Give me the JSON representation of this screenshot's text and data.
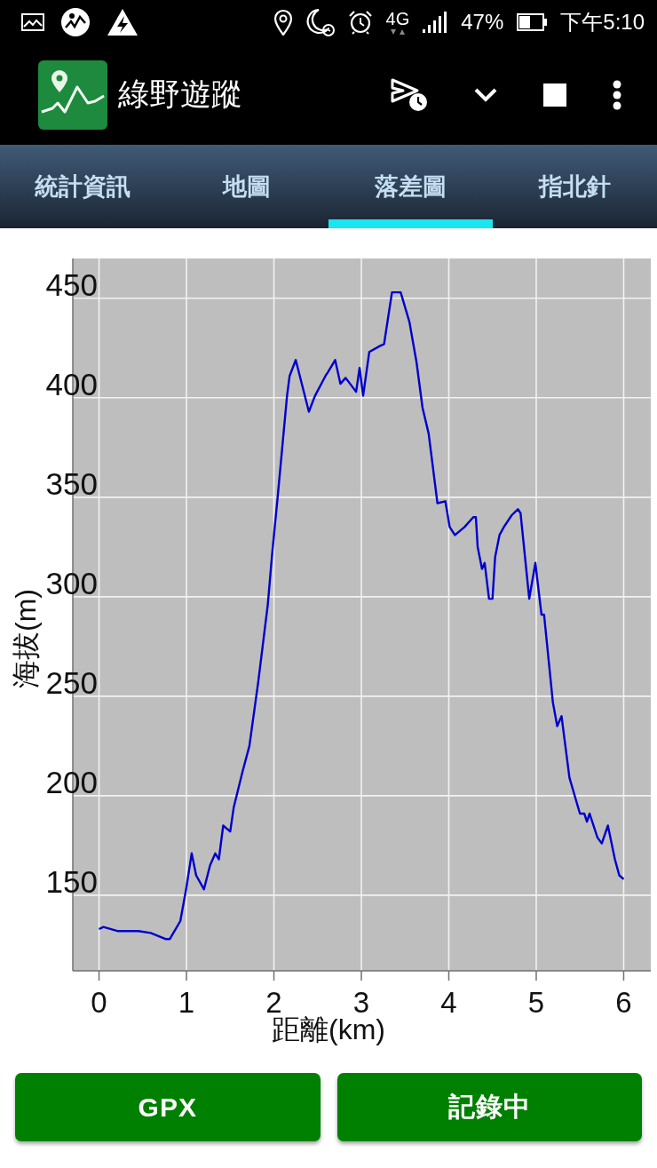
{
  "status_bar": {
    "network": "4G",
    "battery": "47%",
    "time": "下午5:10"
  },
  "app_bar": {
    "title": "綠野遊蹤"
  },
  "tabs": [
    {
      "label": "統計資訊",
      "selected": false
    },
    {
      "label": "地圖",
      "selected": false
    },
    {
      "label": "落差圖",
      "selected": true
    },
    {
      "label": "指北針",
      "selected": false
    }
  ],
  "chart": {
    "chart_data": {
      "type": "line",
      "xlabel": "距離(km)",
      "ylabel": "海拔(m)",
      "x": [
        0,
        0.05,
        0.21,
        0.45,
        0.59,
        0.76,
        0.81,
        0.93,
        1.0,
        1.06,
        1.11,
        1.2,
        1.27,
        1.33,
        1.37,
        1.42,
        1.5,
        1.54,
        1.64,
        1.72,
        1.82,
        1.93,
        1.98,
        2.04,
        2.15,
        2.18,
        2.25,
        2.4,
        2.47,
        2.59,
        2.62,
        2.7,
        2.76,
        2.82,
        2.94,
        2.98,
        3.02,
        3.09,
        3.21,
        3.26,
        3.35,
        3.45,
        3.55,
        3.63,
        3.7,
        3.77,
        3.87,
        3.96,
        4.01,
        4.07,
        4.18,
        4.28,
        4.31,
        4.33,
        4.38,
        4.41,
        4.46,
        4.5,
        4.53,
        4.58,
        4.63,
        4.72,
        4.79,
        4.82,
        4.92,
        4.99,
        5.06,
        5.09,
        5.19,
        5.24,
        5.29,
        5.38,
        5.5,
        5.55,
        5.58,
        5.61,
        5.7,
        5.75,
        5.82,
        5.9,
        5.95,
        6.0
      ],
      "series": [
        {
          "color": "#0000cc",
          "values": [
            133,
            134,
            132,
            132,
            131,
            128,
            128,
            137,
            154,
            171,
            160,
            153,
            165,
            171,
            168,
            185,
            182,
            194,
            212,
            225,
            257,
            296,
            322,
            349,
            401,
            411,
            419,
            393,
            401,
            411,
            413,
            419,
            407,
            410,
            403,
            415,
            401,
            423,
            426,
            427,
            453,
            453,
            438,
            418,
            395,
            382,
            347,
            348,
            335,
            331,
            335,
            340,
            340,
            325,
            314,
            317,
            299,
            299,
            320,
            331,
            335,
            341,
            344,
            342,
            299,
            317,
            291,
            291,
            247,
            235,
            240,
            209,
            191,
            191,
            187,
            191,
            179,
            176,
            185,
            168,
            160,
            158
          ]
        }
      ],
      "xlim": [
        -0.3,
        6.31
      ],
      "ylim": [
        112,
        470
      ],
      "xticks": [
        0,
        1,
        2,
        3,
        4,
        5,
        6
      ],
      "yticks": [
        150,
        200,
        250,
        300,
        350,
        400,
        450
      ],
      "grid": true
    }
  },
  "buttons": [
    {
      "label": "GPX"
    },
    {
      "label": "記錄中"
    }
  ]
}
